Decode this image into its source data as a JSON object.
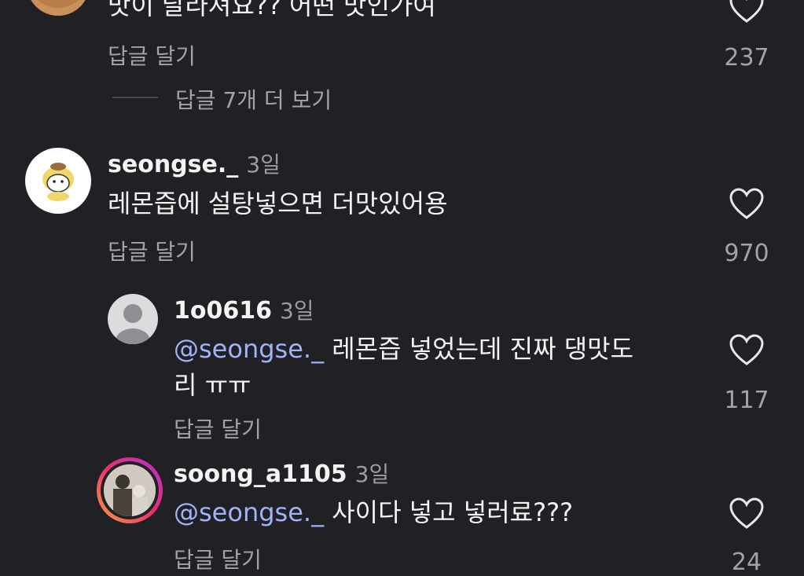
{
  "top_comment": {
    "text": "맛이 달라져요?? 어떤 맛인가여",
    "reply_label": "답글 달기",
    "likes": "237",
    "more_replies": "답글 7개 더 보기"
  },
  "comment_main": {
    "username": "seongse._",
    "time": "3일",
    "text": "레몬즙에 설탕넣으면 더맛있어용",
    "reply_label": "답글 달기",
    "likes": "970"
  },
  "reply1": {
    "username": "1o0616",
    "time": "3일",
    "mention": "@seongse._",
    "text_line1": " 레몬즙 넣었는데 진짜 댕맛도",
    "text_line2": "리 ㅠㅠ",
    "reply_label": "답글 달기",
    "likes": "117"
  },
  "reply2": {
    "username": "soong_a1105",
    "time": "3일",
    "mention": "@seongse._",
    "text": " 사이다 넣고 넣러료???",
    "reply_label": "답글 달기",
    "likes": "24"
  },
  "colors": {
    "background": "#212025",
    "mention": "#9fb3f6",
    "secondary_text": "#a2a2a7"
  }
}
